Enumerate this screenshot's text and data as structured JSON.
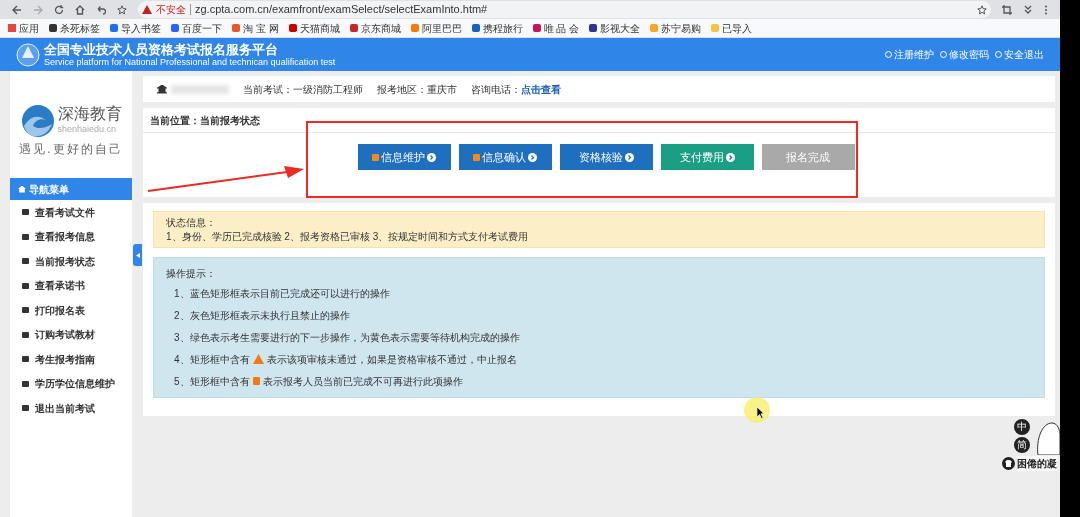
{
  "browser": {
    "security": "不安全",
    "url": "zg.cpta.com.cn/examfront/examSelect/selectExamInto.htm#",
    "bookmarks": [
      "应用",
      "杀死标签",
      "导入书签",
      "百度一下",
      "淘 宝 网",
      "天猫商城",
      "京东商城",
      "阿里巴巴",
      "携程旅行",
      "唯 品 会",
      "影视大全",
      "苏宁易购",
      "已导入"
    ]
  },
  "header": {
    "title": "全国专业技术人员资格考试报名服务平台",
    "subtitle": "Service platform for National Professional and technican qualification test",
    "links": [
      "注册维护",
      "修改密码",
      "安全退出"
    ]
  },
  "sidebar": {
    "logo_name": "深海教育",
    "logo_domain": "shenhaiedu.cn",
    "slogan": "遇见.更好的自己",
    "menu_title": "导航菜单",
    "items": [
      "查看考试文件",
      "查看报考信息",
      "当前报考状态",
      "查看承诺书",
      "打印报名表",
      "订购考试教材",
      "考生报考指南",
      "学历学位信息维护",
      "退出当前考试"
    ]
  },
  "info_bar": [
    {
      "label": "当前考试：",
      "value": "一级消防工程师"
    },
    {
      "label": "报考地区：",
      "value": "重庆市"
    },
    {
      "label": "咨询电话：",
      "value": "点击查看",
      "link": true
    }
  ],
  "breadcrumb": "当前位置：当前报考状态",
  "steps": [
    {
      "label": "信息维护",
      "kind": "done",
      "locked": true
    },
    {
      "label": "信息确认",
      "kind": "done",
      "locked": true
    },
    {
      "label": "资格核验",
      "kind": "done",
      "locked": false
    },
    {
      "label": "支付费用",
      "kind": "next",
      "locked": false
    },
    {
      "label": "报名完成",
      "kind": "disabled",
      "locked": false
    }
  ],
  "status_info": {
    "title": "状态信息：",
    "text": "1、身份、学历已完成核验 2、报考资格已审核 3、按规定时间和方式支付考试费用"
  },
  "tips": {
    "title": "操作提示：",
    "items": [
      {
        "before": "1、蓝色矩形框表示目前已完成还可以进行的操作"
      },
      {
        "before": "2、灰色矩形框表示未执行且禁止的操作"
      },
      {
        "before": "3、绿色表示考生需要进行的下一步操作，为黄色表示需要等待机构完成的操作"
      },
      {
        "before": "4、矩形框中含有",
        "kind": "warning",
        "after": "表示该项审核未通过，如果是资格审核不通过，中止报名"
      },
      {
        "before": "5、矩形框中含有",
        "kind": "lock",
        "after": "表示报考人员当前已完成不可再进行此项操作"
      }
    ]
  },
  "floating": {
    "buttons": [
      "中",
      "简"
    ],
    "sticker_caption": "困倦的凝"
  }
}
